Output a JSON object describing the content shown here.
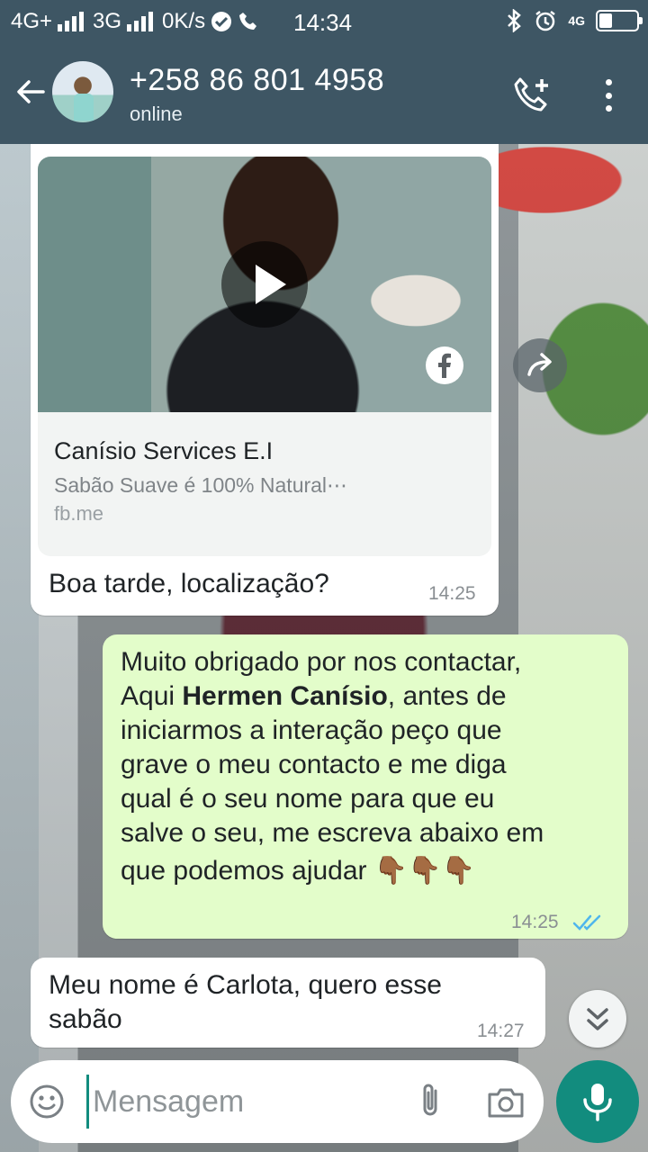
{
  "status_bar": {
    "network_left": "4G+",
    "network_mid": "3G",
    "speed": "0K/s",
    "time": "14:34",
    "net_right": "4G",
    "battery_level": 0.35
  },
  "header": {
    "contact_name": "+258 86 801 4958",
    "status": "online"
  },
  "messages": [
    {
      "direction": "incoming",
      "link_preview": {
        "title": "Canísio Services E.I",
        "description": "Sabão Suave é 100% Natural⋯",
        "url": "fb.me"
      },
      "text": "Boa tarde, localização?",
      "time": "14:25"
    },
    {
      "direction": "outgoing",
      "text_before": "Muito obrigado por nos contactar,",
      "line2_prefix": "Aqui ",
      "bold_name": "Hermen Canísio",
      "line2_suffix": ", antes de",
      "line3": "iniciarmos a interação peço que",
      "line4": "grave o meu contacto e me diga",
      "line5": "qual é o seu nome para que eu",
      "line6": "salve o seu, me escreva abaixo em",
      "line7": "que podemos ajudar",
      "emoji": "👇🏾👇🏾👇🏾",
      "time": "14:25",
      "status_icon": "double-check-read"
    },
    {
      "direction": "incoming",
      "line1": "Meu nome é Carlota, quero esse",
      "line2": "sabão",
      "time": "14:27"
    }
  ],
  "input": {
    "placeholder": "Mensagem"
  },
  "icons": {
    "back": "arrow-left-icon",
    "call": "add-call-icon",
    "menu": "more-vertical-icon",
    "emoji": "emoji-icon",
    "attach": "paperclip-icon",
    "camera": "camera-icon",
    "mic": "mic-icon",
    "play": "play-icon",
    "facebook": "facebook-icon",
    "forward": "forward-icon",
    "scroll": "chevron-double-down-icon"
  },
  "colors": {
    "header": "#3e5664",
    "outgoing_bubble": "#e3fdca",
    "accent": "#128c7e",
    "read_ticks": "#4fb6ec"
  }
}
